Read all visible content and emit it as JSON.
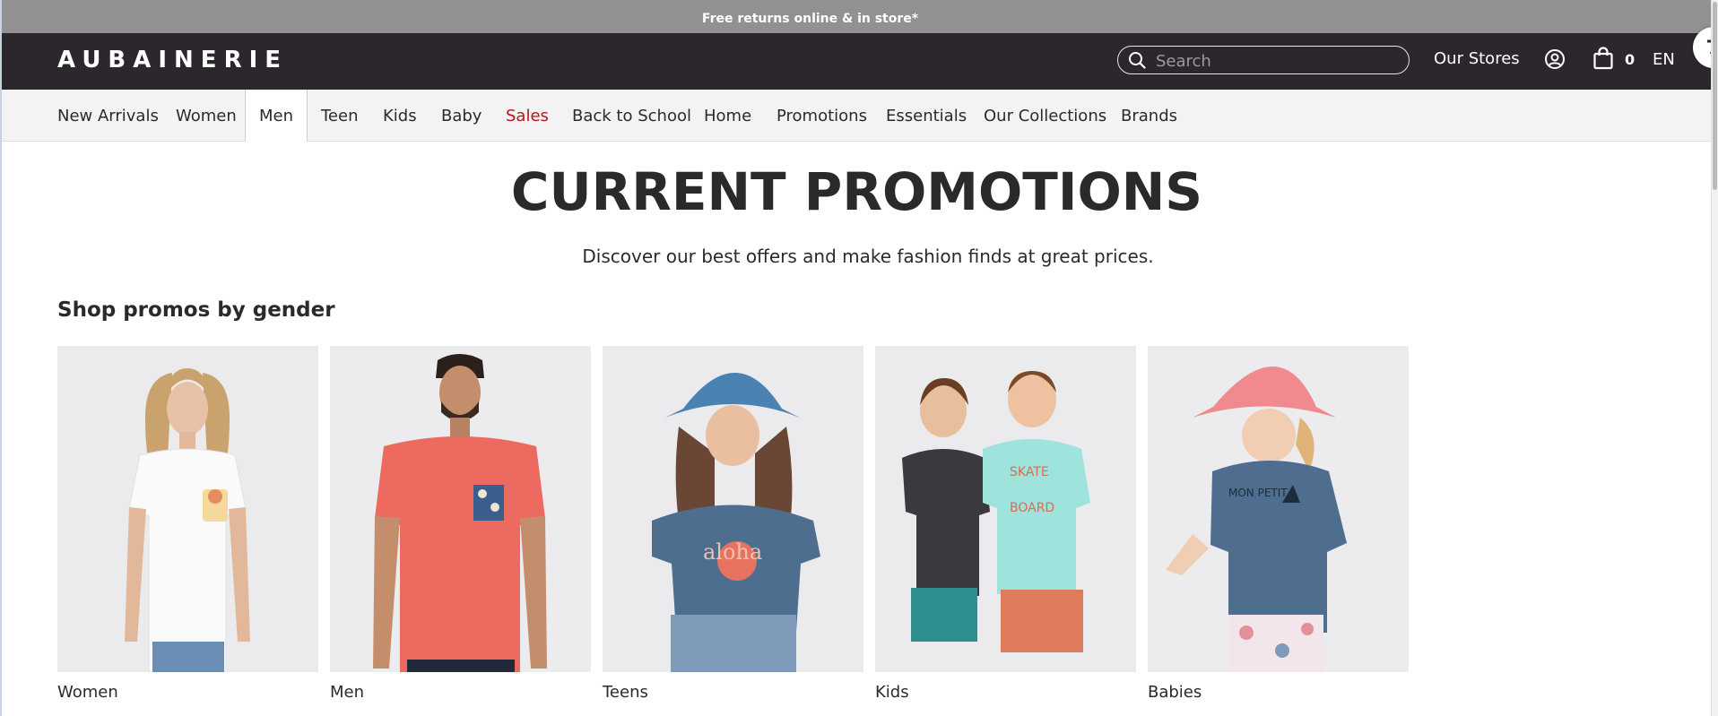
{
  "promo_bar": {
    "text": "Free returns online & in store*"
  },
  "header": {
    "logo": "AUBAINERIE",
    "search": {
      "placeholder": "Search",
      "icon": "search-icon"
    },
    "our_stores": "Our Stores",
    "account_icon": "user-circle-icon",
    "bag_icon": "shopping-bag-icon",
    "bag_count": "0",
    "language": "EN"
  },
  "nav": {
    "items": [
      {
        "label": "New Arrivals"
      },
      {
        "label": "Women"
      },
      {
        "label": "Men"
      },
      {
        "label": "Teen"
      },
      {
        "label": "Kids"
      },
      {
        "label": "Baby"
      },
      {
        "label": "Sales"
      },
      {
        "label": "Back to School"
      },
      {
        "label": "Home"
      },
      {
        "label": "Promotions"
      },
      {
        "label": "Essentials"
      },
      {
        "label": "Our Collections"
      },
      {
        "label": "Brands"
      }
    ],
    "active": "Men",
    "highlight": "Sales"
  },
  "content": {
    "title": "CURRENT PROMOTIONS",
    "subtitle": "Discover our best offers and make fashion finds at great prices.",
    "section_heading": "Shop promos by gender",
    "cards": [
      {
        "label": "Women"
      },
      {
        "label": "Men"
      },
      {
        "label": "Teens"
      },
      {
        "label": "Kids"
      },
      {
        "label": "Babies"
      }
    ]
  },
  "colors": {
    "promo_bar_bg": "#919191",
    "header_bg": "#2c272d",
    "nav_bg": "#f3f3f3",
    "sale_red": "#b8141c",
    "text": "#2a2a2a"
  }
}
